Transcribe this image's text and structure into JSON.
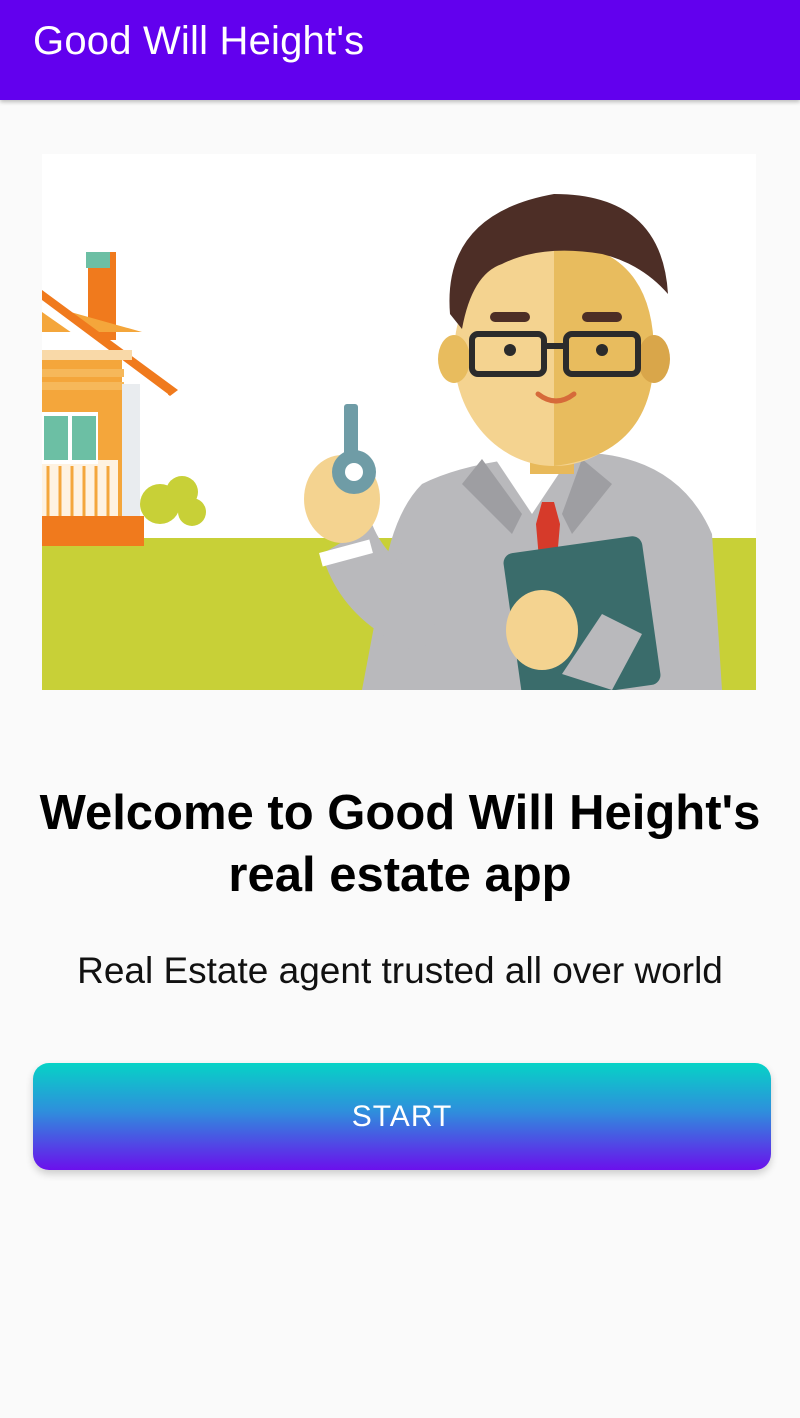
{
  "app_bar": {
    "title": "Good Will Height's"
  },
  "hero": {
    "illustration": "real-estate-agent-holding-key-illustration"
  },
  "content": {
    "welcome_title": "Welcome to Good Will Height's real estate app",
    "subtitle": "Real Estate agent trusted all over world"
  },
  "actions": {
    "start_label": "START"
  },
  "colors": {
    "primary": "#6200ee",
    "button_gradient_top": "#06d3c6",
    "button_gradient_bottom": "#6b10ec",
    "background": "#fafafa"
  }
}
